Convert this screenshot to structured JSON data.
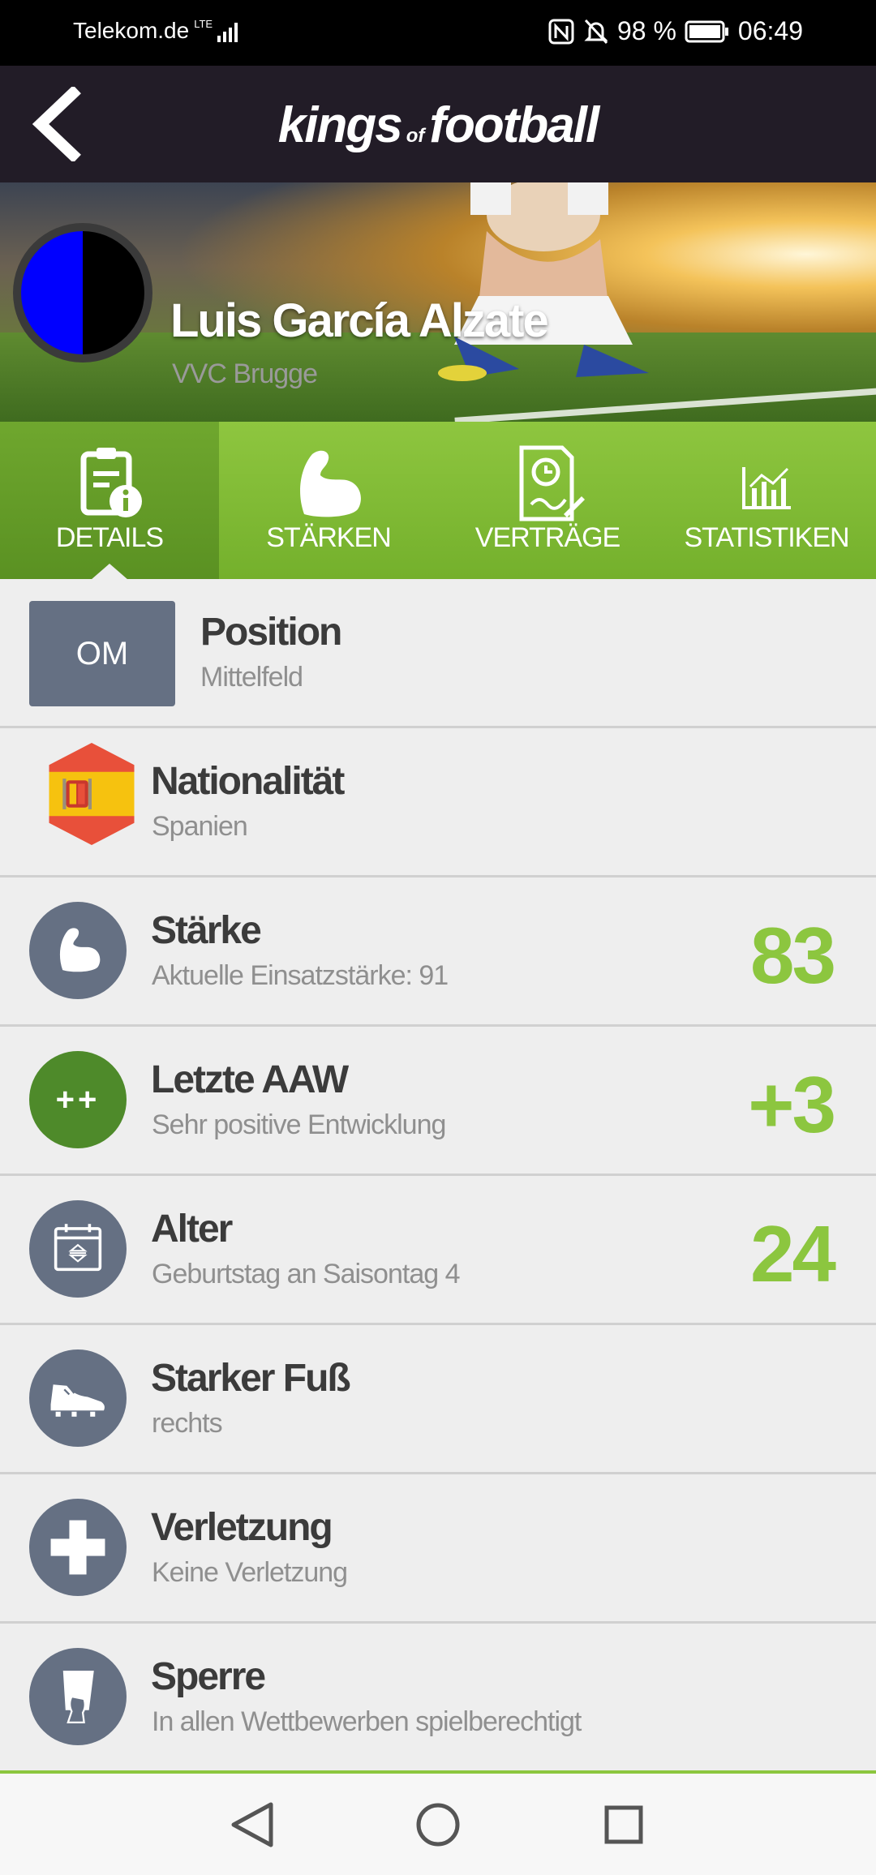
{
  "status_bar": {
    "carrier": "Telekom.de",
    "network": "LTE",
    "battery": "98 %",
    "time": "06:49"
  },
  "header": {
    "logo_main": "kings",
    "logo_of": "of",
    "logo_end": "football"
  },
  "player": {
    "name": "Luis García Alzate",
    "club": "VVC Brugge",
    "crest_colors": [
      "#0000ff",
      "#000000"
    ]
  },
  "tabs": [
    {
      "label": "DETAILS",
      "icon": "clipboard-info-icon",
      "active": true
    },
    {
      "label": "STÄRKEN",
      "icon": "flexed-arm-icon",
      "active": false
    },
    {
      "label": "VERTRÄGE",
      "icon": "contract-clock-icon",
      "active": false
    },
    {
      "label": "STATISTIKEN",
      "icon": "bar-chart-icon",
      "active": false
    }
  ],
  "details": {
    "position": {
      "badge": "OM",
      "title": "Position",
      "sub": "Mittelfeld"
    },
    "nationality": {
      "title": "Nationalität",
      "sub": "Spanien",
      "icon": "spain-flag-icon"
    },
    "strength": {
      "title": "Stärke",
      "sub": "Aktuelle Einsatzstärke: 91",
      "value": "83",
      "icon": "flexed-arm-icon"
    },
    "last_aaw": {
      "title": "Letzte AAW",
      "sub": "Sehr positive Entwicklung",
      "value": "+3",
      "badge": "++"
    },
    "age": {
      "title": "Alter",
      "sub": "Geburtstag an Saisontag 4",
      "value": "24",
      "icon": "calendar-icon"
    },
    "foot": {
      "title": "Starker Fuß",
      "sub": "rechts",
      "icon": "football-boot-icon"
    },
    "injury": {
      "title": "Verletzung",
      "sub": "Keine Verletzung",
      "icon": "medical-cross-icon"
    },
    "suspension": {
      "title": "Sperre",
      "sub": "In allen Wettbewerben spielberechtigt",
      "icon": "referee-card-icon"
    }
  },
  "colors": {
    "accent_green": "#8cc63f",
    "icon_slate": "#657083",
    "positive_green": "#4e8a2a",
    "topbar": "#221c27"
  }
}
